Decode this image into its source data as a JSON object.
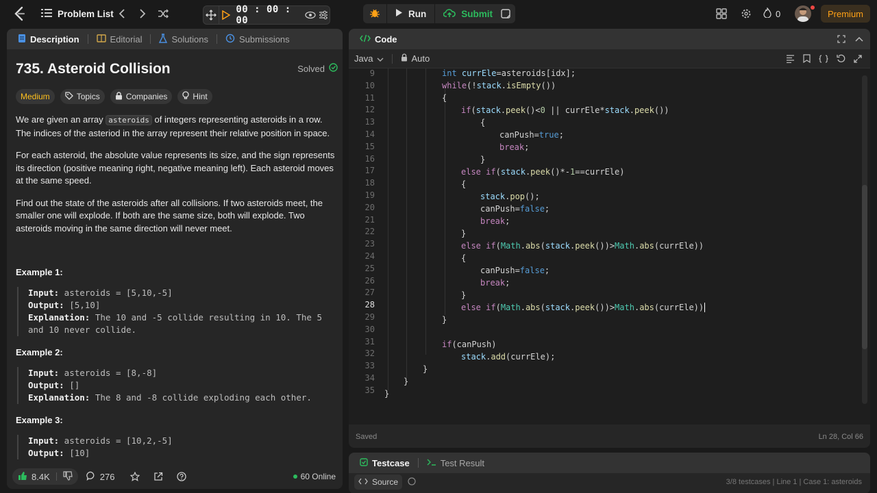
{
  "topbar": {
    "problem_list": "Problem List",
    "timer": "00 : 00 : 00",
    "run": "Run",
    "submit": "Submit",
    "streak_count": "0",
    "premium": "Premium"
  },
  "left": {
    "tabs": [
      "Description",
      "Editorial",
      "Solutions",
      "Submissions"
    ],
    "title": "735. Asteroid Collision",
    "solved": "Solved",
    "tags": [
      "Medium",
      "Topics",
      "Companies",
      "Hint"
    ],
    "para1_a": "We are given an array ",
    "para1_code": "asteroids",
    "para1_b": " of integers representing asteroids in a row. The indices of the asteriod in the array represent their relative position in space.",
    "para2": "For each asteroid, the absolute value represents its size, and the sign represents its direction (positive meaning right, negative meaning left). Each asteroid moves at the same speed.",
    "para3": "Find out the state of the asteroids after all collisions. If two asteroids meet, the smaller one will explode. If both are the same size, both will explode. Two asteroids moving in the same direction will never meet.",
    "examples": [
      {
        "title": "Example 1:",
        "input_label": "Input:",
        "input": " asteroids = [5,10,-5]",
        "output_label": "Output:",
        "output": " [5,10]",
        "expl_label": "Explanation:",
        "expl": " The 10 and -5 collide resulting in 10. The 5 and 10 never collide."
      },
      {
        "title": "Example 2:",
        "input_label": "Input:",
        "input": " asteroids = [8,-8]",
        "output_label": "Output:",
        "output": " []",
        "expl_label": "Explanation:",
        "expl": " The 8 and -8 collide exploding each other."
      },
      {
        "title": "Example 3:",
        "input_label": "Input:",
        "input": " asteroids = [10,2,-5]",
        "output_label": "Output:",
        "output": " [10]"
      }
    ],
    "footer": {
      "likes": "8.4K",
      "comments": "276",
      "online": "60 Online"
    }
  },
  "code": {
    "tab": "Code",
    "language": "Java",
    "mode": "Auto",
    "status_left": "Saved",
    "status_right": "Ln 28, Col 66",
    "line_numbers": [
      "9",
      "10",
      "11",
      "12",
      "13",
      "14",
      "15",
      "16",
      "17",
      "18",
      "19",
      "20",
      "21",
      "22",
      "23",
      "24",
      "25",
      "26",
      "27",
      "28",
      "29",
      "30",
      "31",
      "32",
      "33",
      "34",
      "35"
    ]
  },
  "test": {
    "tabs": [
      "Testcase",
      "Test Result"
    ],
    "source": "Source",
    "right_info": "3/8 testcases  |  Line 1  |  Case 1: asteroids"
  }
}
